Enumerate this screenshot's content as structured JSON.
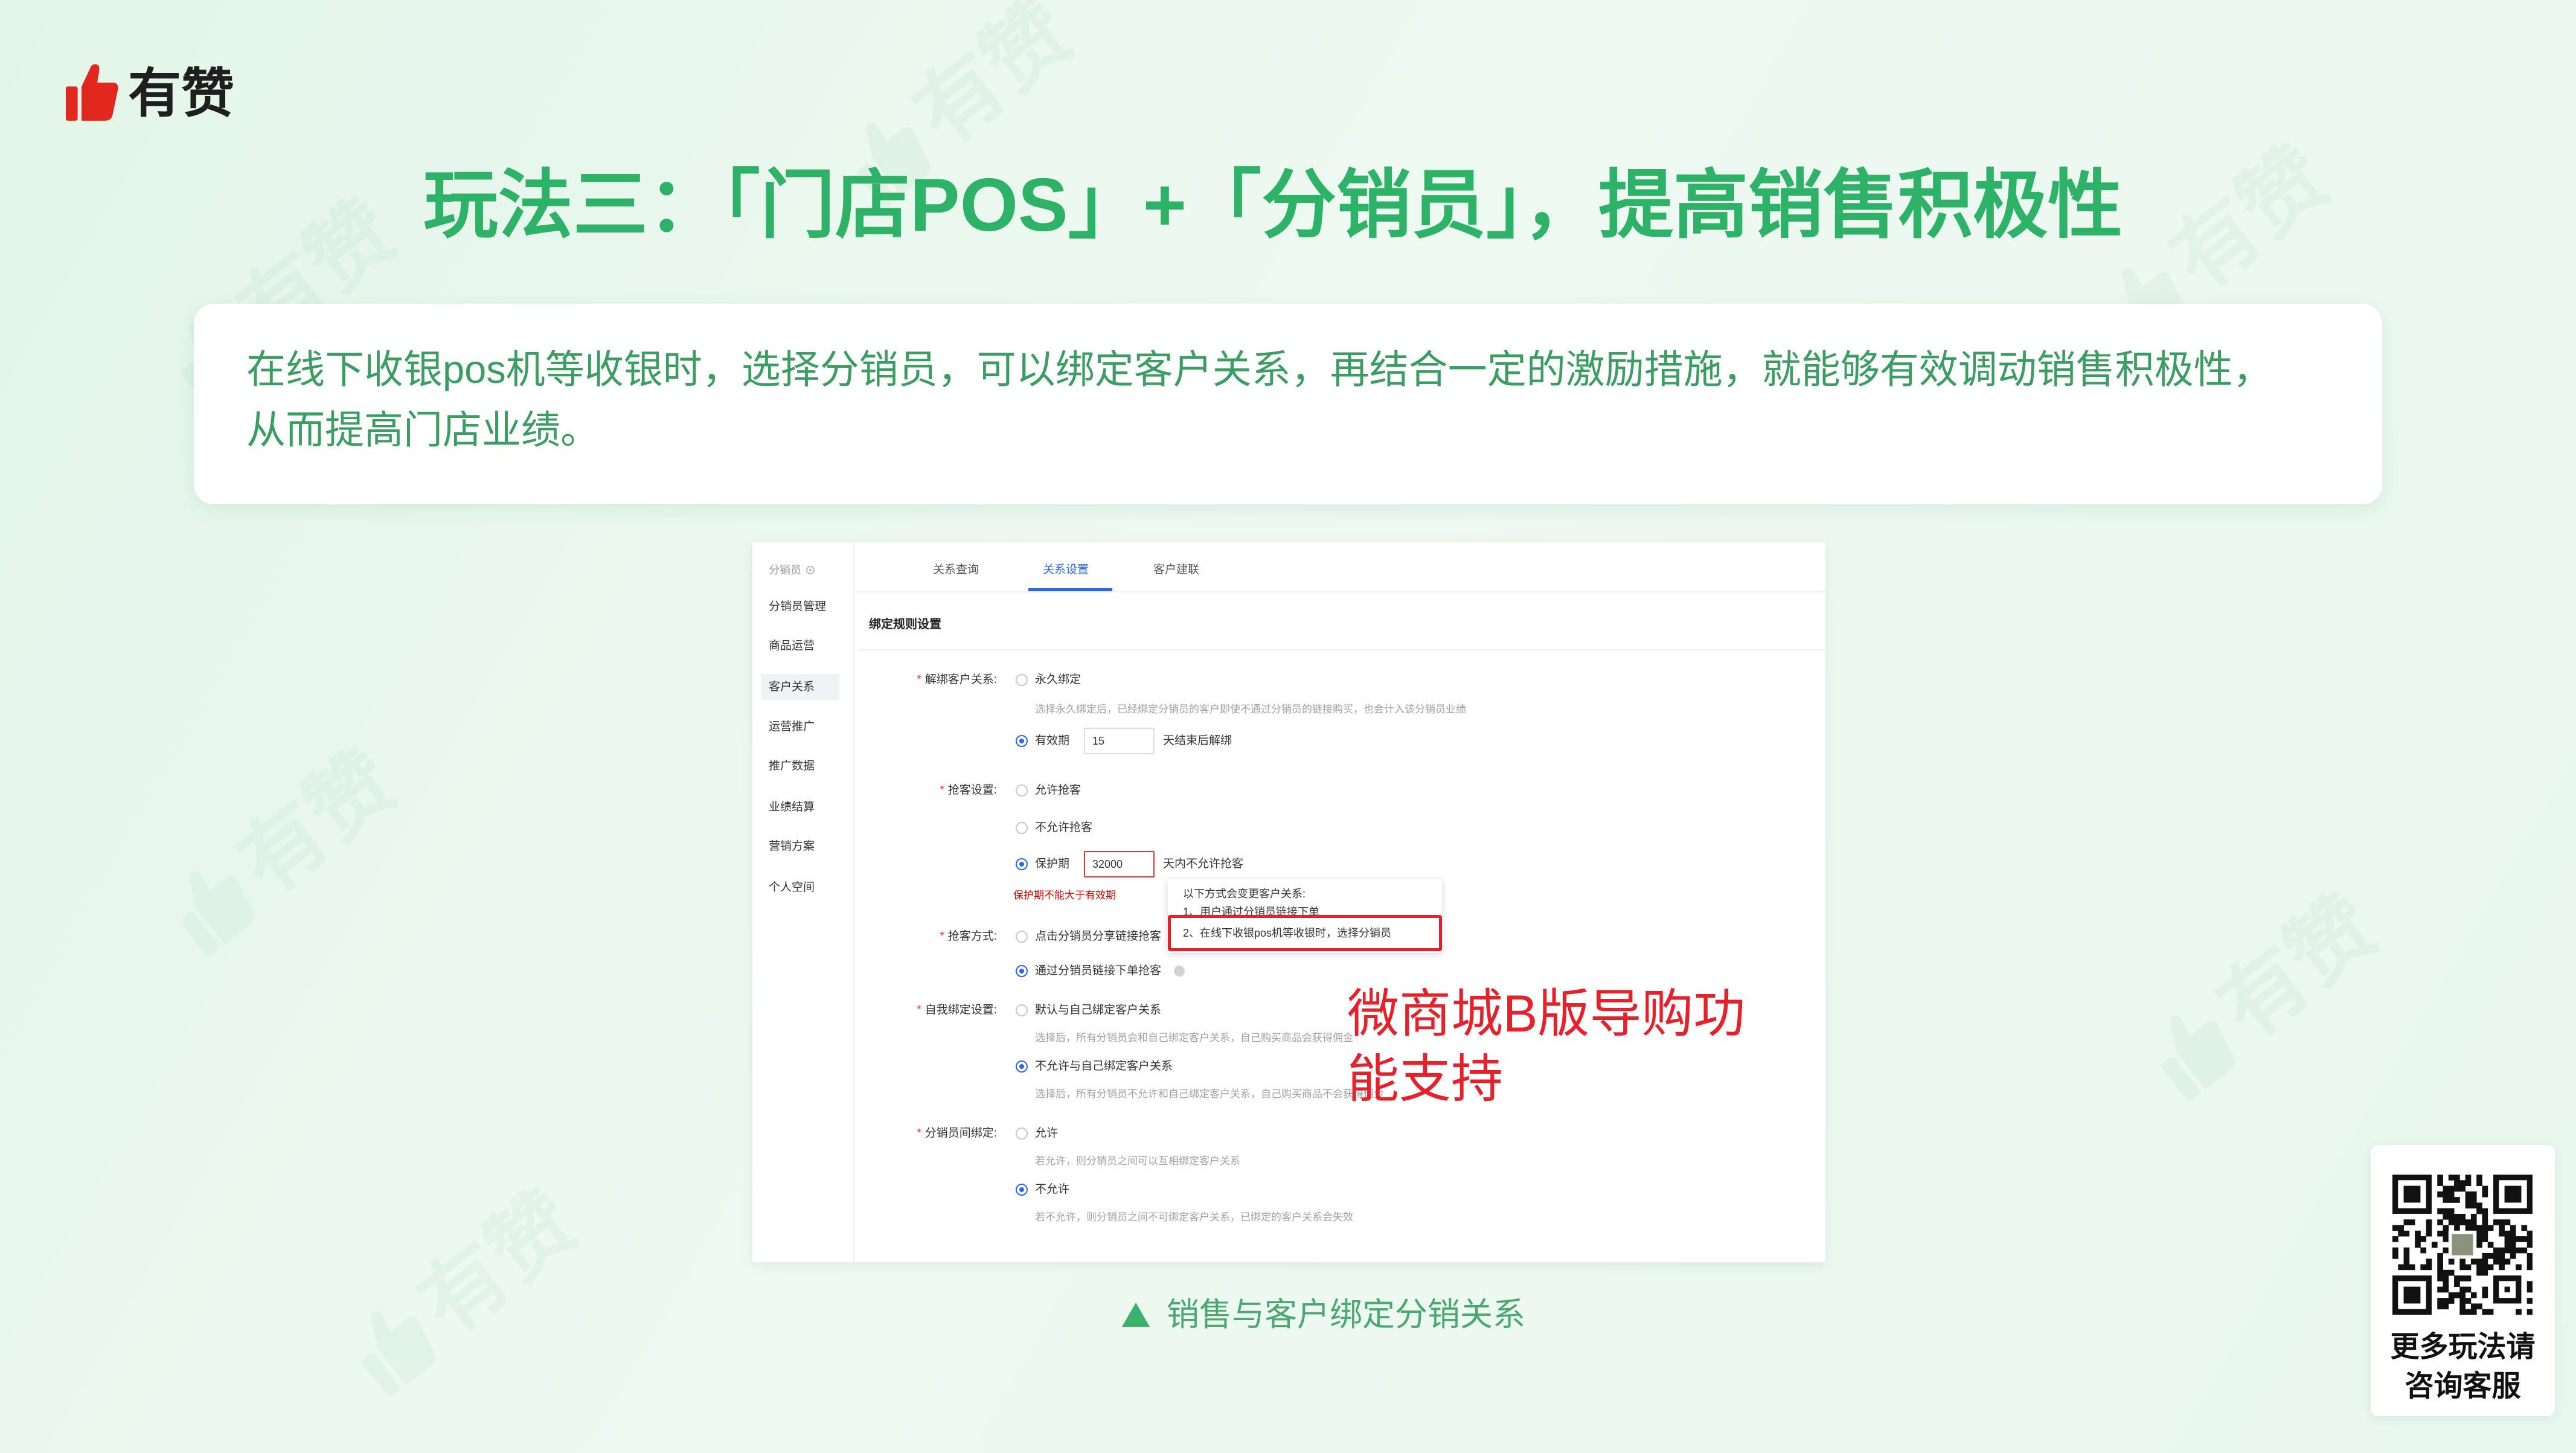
{
  "brand": {
    "logo_text": "有赞",
    "logo_icon": "thumbs-up-icon"
  },
  "watermark": "有赞",
  "title": "玩法三：「门店POS」+「分销员」，提高销售积极性",
  "intro": {
    "lines": [
      "在线下收银pos机等收银时，选择分销员，可以绑定客户关系，再结合一定的激励措施，就能够有效调动销售积极性，",
      "从而提高门店业绩。"
    ]
  },
  "screenshot": {
    "sidebar": {
      "header": "分销员",
      "header_icon": "collapse-icon",
      "items": [
        "分销员管理",
        "商品运营",
        "客户关系",
        "运营推广",
        "推广数据",
        "业绩结算",
        "营销方案",
        "个人空间"
      ],
      "active": "客户关系"
    },
    "tabs": [
      {
        "label": "关系查询",
        "active": false
      },
      {
        "label": "关系设置",
        "active": true
      },
      {
        "label": "客户建联",
        "active": false
      }
    ],
    "section_title": "绑定规则设置",
    "required_mark": "*",
    "form": {
      "unbind": {
        "label": "解绑客户关系:",
        "opt_permanent": "永久绑定",
        "help_permanent": "选择永久绑定后，已经绑定分销员的客户即使不通过分销员的链接购买，也会计入该分销员业绩",
        "opt_validity": "有效期",
        "validity_value": "15",
        "validity_suffix": "天结束后解绑",
        "selected": "有效期"
      },
      "grab": {
        "label": "抢客设置:",
        "opt_allow": "允许抢客",
        "opt_deny": "不允许抢客",
        "opt_protect": "保护期",
        "protect_value": "32000",
        "protect_suffix": "天内不允许抢客",
        "error": "保护期不能大于有效期",
        "selected": "保护期"
      },
      "grab_method": {
        "label": "抢客方式:",
        "opt_click": "点击分销员分享链接抢客",
        "opt_order": "通过分销员链接下单抢客",
        "selected": "通过分销员链接下单抢客"
      },
      "self_bind": {
        "label": "自我绑定设置:",
        "opt_default": "默认与自己绑定客户关系",
        "help_default": "选择后，所有分销员会和自己绑定客户关系，自己购买商品会获得佣金",
        "opt_deny": "不允许与自己绑定客户关系",
        "help_deny": "选择后，所有分销员不允许和自己绑定客户关系，自己购买商品不会获得佣金",
        "selected": "不允许与自己绑定客户关系"
      },
      "peer_bind": {
        "label": "分销员间绑定:",
        "opt_allow": "允许",
        "help_allow": "若允许，则分销员之间可以互相绑定客户关系",
        "opt_deny": "不允许",
        "help_deny": "若不允许，则分销员之间不可绑定客户关系，已绑定的客户关系会失效",
        "selected": "不允许"
      }
    },
    "tooltip": {
      "title": "以下方式会变更客户关系:",
      "item1": "1、用户通过分销员链接下单",
      "item2": "2、在线下收银pos机等收银时，选择分销员"
    },
    "annotation": "微商城B版导购功能支持"
  },
  "caption": {
    "icon": "triangle-up-icon",
    "text": "销售与客户绑定分销关系"
  },
  "qr": {
    "line1": "更多玩法请",
    "line2": "咨询客服"
  },
  "colors": {
    "accent_green": "#2eb267",
    "brand_red": "#e2281e",
    "link_blue": "#2c68e6",
    "annotation_red": "#e5212b"
  }
}
